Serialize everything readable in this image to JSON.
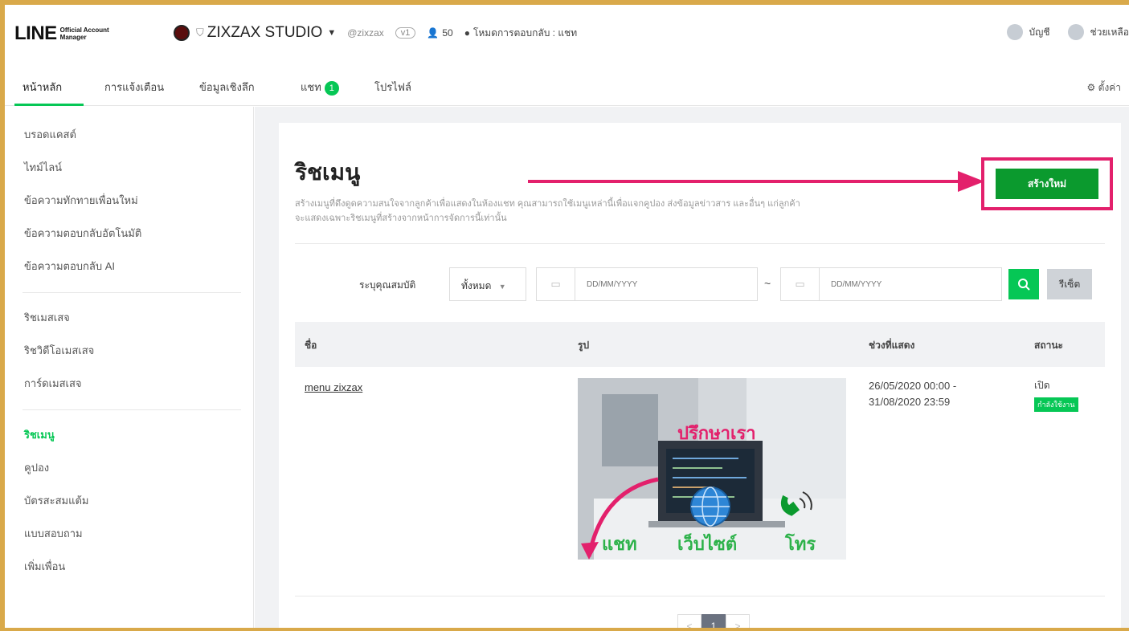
{
  "header": {
    "logo_main": "LINE",
    "logo_sub_1": "Official Account",
    "logo_sub_2": "Manager",
    "account_name": "ZIXZAX STUDIO",
    "account_id": "@zixzax",
    "level_badge": "v1",
    "friends_count": "50",
    "reply_mode": "โหมดการตอบกลับ : แชท",
    "account_menu": "บัญชี",
    "help_menu": "ช่วยเหลือ"
  },
  "nav": {
    "tabs": [
      {
        "label": "หน้าหลัก"
      },
      {
        "label": "การแจ้งเตือน"
      },
      {
        "label": "ข้อมูลเชิงลึก"
      },
      {
        "label": "แชท"
      },
      {
        "label": "โปรไฟล์"
      }
    ],
    "chat_badge": "1",
    "settings": "ตั้งค่า"
  },
  "sidebar": {
    "group1": [
      {
        "label": "บรอดแคสต์"
      },
      {
        "label": "ไทม์ไลน์"
      },
      {
        "label": "ข้อความทักทายเพื่อนใหม่"
      },
      {
        "label": "ข้อความตอบกลับอัตโนมัติ"
      },
      {
        "label": "ข้อความตอบกลับ AI"
      }
    ],
    "group2": [
      {
        "label": "ริชเมสเสจ"
      },
      {
        "label": "ริชวิดีโอเมสเสจ"
      },
      {
        "label": "การ์ดเมสเสจ"
      }
    ],
    "group3": [
      {
        "label": "ริชเมนู"
      },
      {
        "label": "คูปอง"
      },
      {
        "label": "บัตรสะสมแต้ม"
      },
      {
        "label": "แบบสอบถาม"
      },
      {
        "label": "เพิ่มเพื่อน"
      }
    ]
  },
  "page": {
    "title": "ริชเมนู",
    "description_1": "สร้างเมนูที่ดึงดูดความสนใจจากลูกค้าเพื่อแสดงในห้องแชท คุณสามารถใช้เมนูเหล่านี้เพื่อแจกคูปอง ส่งข้อมูลข่าวสาร และอื่นๆ แก่ลูกค้า",
    "description_2": "จะแสดงเฉพาะริชเมนูที่สร้างจากหน้าการจัดการนี้เท่านั้น",
    "create_button": "สร้างใหม่"
  },
  "filter": {
    "label": "ระบุคุณสมบัติ",
    "select_value": "ทั้งหมด",
    "date_placeholder_from": "DD/MM/YYYY",
    "date_placeholder_to": "DD/MM/YYYY",
    "tilde": "~",
    "reset_button": "รีเซ็ต"
  },
  "table": {
    "headers": {
      "name": "ชื่อ",
      "image": "รูป",
      "period": "ช่วงที่แสดง",
      "status": "สถานะ"
    },
    "rows": [
      {
        "name": "menu zixzax",
        "period_start": "26/05/2020 00:00 -",
        "period_end": "31/08/2020 23:59",
        "status": "เปิด",
        "status_tag": "กำลังใช้งาน",
        "image_labels": {
          "top": "ปรึกษาเรา",
          "left": "แชท",
          "mid": "เว็บไซต์",
          "right": "โทร"
        }
      }
    ]
  },
  "pagination": {
    "prev": "<",
    "current": "1",
    "next": ">"
  },
  "colors": {
    "accent": "#06c755",
    "highlight": "#e3206c",
    "create_btn": "#0b9a2e"
  }
}
